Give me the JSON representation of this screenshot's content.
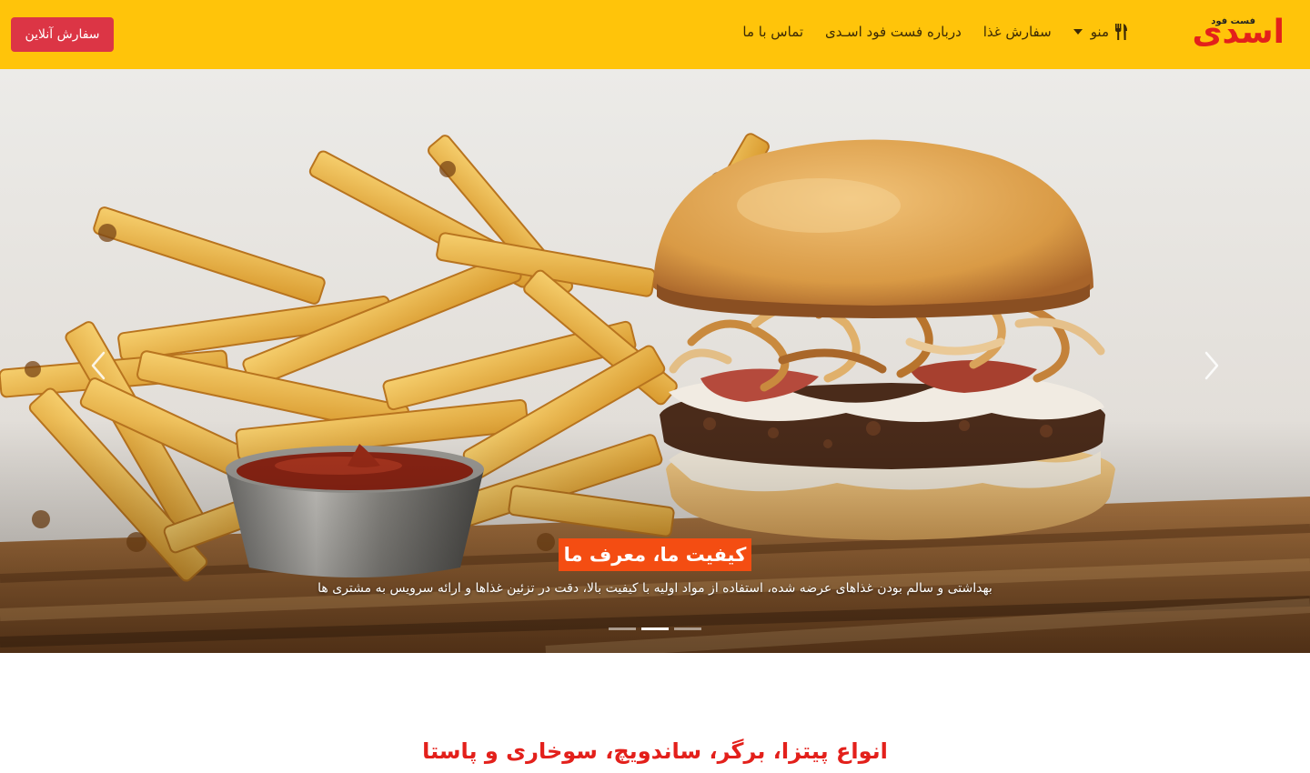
{
  "brand": {
    "name": "اسدی",
    "tagline": "فست فود",
    "color": "#e3201b"
  },
  "navbar": {
    "background": "#ffc40a",
    "links": [
      {
        "label": "منو",
        "icon": "utensils-icon",
        "dropdown": true
      },
      {
        "label": "سفارش غذا"
      },
      {
        "label": "درباره فست فود اسـدی"
      },
      {
        "label": "تماس با ما"
      }
    ],
    "order_button": {
      "label": "سفارش آنلاین",
      "color": "#dc3545"
    }
  },
  "hero": {
    "caption_title": "کیفیت ما، معرف ما",
    "caption_text": "بهداشتی و سالم بودن غذاهای عرضه شده، استفاده از مواد اولیه با کیفیت بالا، دقت در تزئین غذاها و ارائه سرویس به مشتری ها",
    "caption_title_bg": "#f44d12",
    "slides_count": 3,
    "active_slide": 2
  },
  "section": {
    "heading": "انواع پیتزا، برگر، ساندویچ، سوخاری و پاستا"
  }
}
